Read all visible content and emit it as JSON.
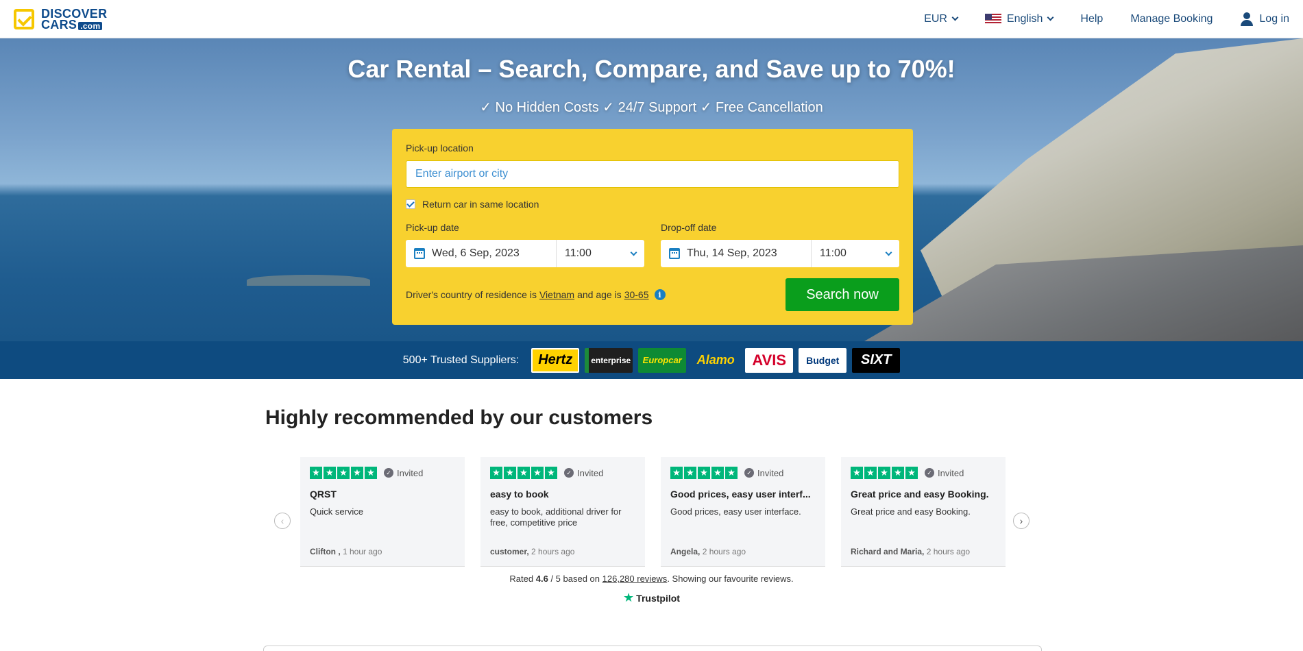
{
  "header": {
    "logo_line1": "DISCOVER",
    "logo_line2": "CARS",
    "logo_com": ".com",
    "currency": "EUR",
    "language": "English",
    "help": "Help",
    "manage_booking": "Manage Booking",
    "login": "Log in"
  },
  "hero": {
    "title": "Car Rental – Search, Compare, and Save up to 70%!",
    "subtitle": "✓ No Hidden Costs ✓ 24/7 Support ✓ Free Cancellation"
  },
  "search": {
    "pickup_location_label": "Pick-up location",
    "pickup_location_placeholder": "Enter airport or city",
    "return_same_label": "Return car in same location",
    "pickup_date_label": "Pick-up date",
    "pickup_date": "Wed, 6 Sep, 2023",
    "pickup_time": "11:00",
    "dropoff_date_label": "Drop-off date",
    "dropoff_date": "Thu, 14 Sep, 2023",
    "dropoff_time": "11:00",
    "driver_prefix": "Driver's country of residence is",
    "driver_country": "Vietnam",
    "driver_mid": "and age is",
    "driver_age": "30-65",
    "search_button": "Search now"
  },
  "suppliers": {
    "label": "500+ Trusted Suppliers:",
    "items": [
      "Hertz",
      "enterprise",
      "Europcar",
      "Alamo",
      "AVIS",
      "Budget",
      "SIXT"
    ]
  },
  "reviews": {
    "title": "Highly recommended by our customers",
    "invited_label": "Invited",
    "cards": [
      {
        "title": "QRST",
        "body": "Quick service",
        "author": "Clifton ,",
        "time": "1 hour ago"
      },
      {
        "title": "easy to book",
        "body": "easy to book, additional driver for free, competitive price",
        "author": "customer,",
        "time": "2 hours ago"
      },
      {
        "title": "Good prices, easy user interf...",
        "body": "Good prices, easy user interface.",
        "author": "Angela,",
        "time": "2 hours ago"
      },
      {
        "title": "Great price and easy Booking.",
        "body": "Great price and easy Booking.",
        "author": "Richard and Maria,",
        "time": "2 hours ago"
      }
    ],
    "rated_prefix": "Rated",
    "rating": "4.6",
    "rated_mid": "/ 5 based on",
    "review_count": "126,280 reviews",
    "rated_suffix": ". Showing our favourite reviews.",
    "trustpilot": "Trustpilot"
  },
  "colors": {
    "accent_yellow": "#f8d12f",
    "search_green": "#0a9e1c",
    "brand_blue": "#0e4b80",
    "trustpilot_green": "#00b67a"
  }
}
